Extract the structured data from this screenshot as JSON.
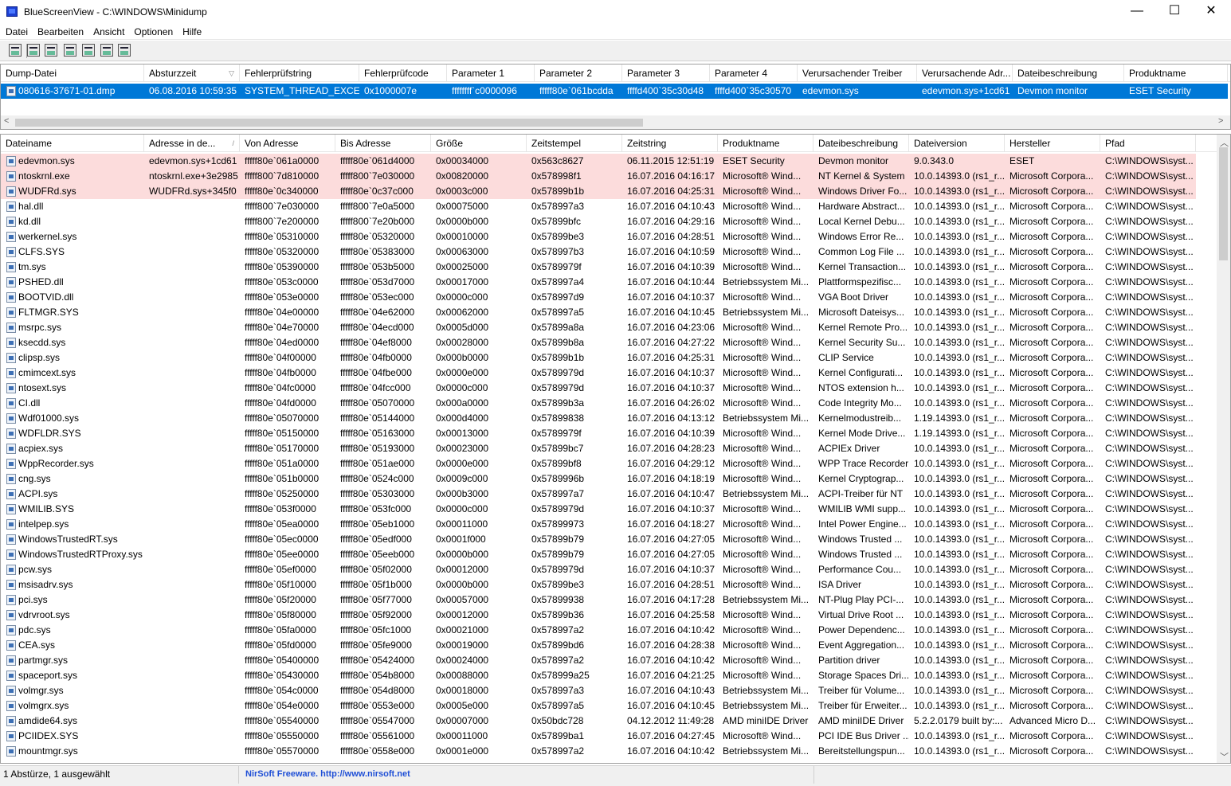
{
  "window": {
    "title": "BlueScreenView  -  C:\\WINDOWS\\Minidump",
    "minimize_glyph": "—",
    "maximize_glyph": "☐",
    "close_glyph": "✕"
  },
  "menu": [
    "Datei",
    "Bearbeiten",
    "Ansicht",
    "Optionen",
    "Hilfe"
  ],
  "toolbar_icons": [
    "properties-icon",
    "save-icon",
    "refresh-icon",
    "copy-icon",
    "html-report-icon",
    "find-icon",
    "exit-icon"
  ],
  "top_table": {
    "columns": [
      "Dump-Datei",
      "Absturzzeit",
      "Fehlerprüfstring",
      "Fehlerprüfcode",
      "Parameter 1",
      "Parameter 2",
      "Parameter 3",
      "Parameter 4",
      "Verursachender Treiber",
      "Verursachende Adr...",
      "Dateibeschreibung",
      "Produktname"
    ],
    "sort_column": "Absturzzeit",
    "sort_glyph": "▽",
    "rows": [
      [
        "080616-37671-01.dmp",
        "06.08.2016 10:59:35",
        "SYSTEM_THREAD_EXCE...",
        "0x1000007e",
        "ffffffff`c0000096",
        "fffff80e`061bcdda",
        "ffffd400`35c30d48",
        "ffffd400`35c30570",
        "edevmon.sys",
        "edevmon.sys+1cd61",
        "Devmon monitor",
        "ESET Security"
      ]
    ]
  },
  "bottom_table": {
    "columns": [
      "Dateiname",
      "Adresse in de...",
      "Von Adresse",
      "Bis Adresse",
      "Größe",
      "Zeitstempel",
      "Zeitstring",
      "Produktname",
      "Dateibeschreibung",
      "Dateiversion",
      "Hersteller",
      "Pfad"
    ],
    "sort_glyph": "/",
    "rows": [
      [
        "edevmon.sys",
        "edevmon.sys+1cd61",
        "fffff80e`061a0000",
        "fffff80e`061d4000",
        "0x00034000",
        "0x563c8627",
        "06.11.2015 12:51:19",
        "ESET Security",
        "Devmon monitor",
        "9.0.343.0",
        "ESET",
        "C:\\WINDOWS\\syst..."
      ],
      [
        "ntoskrnl.exe",
        "ntoskrnl.exe+3e2985",
        "fffff800`7d810000",
        "fffff800`7e030000",
        "0x00820000",
        "0x578998f1",
        "16.07.2016 04:16:17",
        "Microsoft® Wind...",
        "NT Kernel & System",
        "10.0.14393.0 (rs1_r...",
        "Microsoft Corpora...",
        "C:\\WINDOWS\\syst..."
      ],
      [
        "WUDFRd.sys",
        "WUDFRd.sys+345f0",
        "fffff80e`0c340000",
        "fffff80e`0c37c000",
        "0x0003c000",
        "0x57899b1b",
        "16.07.2016 04:25:31",
        "Microsoft® Wind...",
        "Windows Driver Fo...",
        "10.0.14393.0 (rs1_r...",
        "Microsoft Corpora...",
        "C:\\WINDOWS\\syst..."
      ],
      [
        "hal.dll",
        "",
        "fffff800`7e030000",
        "fffff800`7e0a5000",
        "0x00075000",
        "0x578997a3",
        "16.07.2016 04:10:43",
        "Microsoft® Wind...",
        "Hardware Abstract...",
        "10.0.14393.0 (rs1_r...",
        "Microsoft Corpora...",
        "C:\\WINDOWS\\syst..."
      ],
      [
        "kd.dll",
        "",
        "fffff800`7e200000",
        "fffff800`7e20b000",
        "0x0000b000",
        "0x57899bfc",
        "16.07.2016 04:29:16",
        "Microsoft® Wind...",
        "Local Kernel Debu...",
        "10.0.14393.0 (rs1_r...",
        "Microsoft Corpora...",
        "C:\\WINDOWS\\syst..."
      ],
      [
        "werkernel.sys",
        "",
        "fffff80e`05310000",
        "fffff80e`05320000",
        "0x00010000",
        "0x57899be3",
        "16.07.2016 04:28:51",
        "Microsoft® Wind...",
        "Windows Error Re...",
        "10.0.14393.0 (rs1_r...",
        "Microsoft Corpora...",
        "C:\\WINDOWS\\syst..."
      ],
      [
        "CLFS.SYS",
        "",
        "fffff80e`05320000",
        "fffff80e`05383000",
        "0x00063000",
        "0x578997b3",
        "16.07.2016 04:10:59",
        "Microsoft® Wind...",
        "Common Log File ...",
        "10.0.14393.0 (rs1_r...",
        "Microsoft Corpora...",
        "C:\\WINDOWS\\syst..."
      ],
      [
        "tm.sys",
        "",
        "fffff80e`05390000",
        "fffff80e`053b5000",
        "0x00025000",
        "0x5789979f",
        "16.07.2016 04:10:39",
        "Microsoft® Wind...",
        "Kernel Transaction...",
        "10.0.14393.0 (rs1_r...",
        "Microsoft Corpora...",
        "C:\\WINDOWS\\syst..."
      ],
      [
        "PSHED.dll",
        "",
        "fffff80e`053c0000",
        "fffff80e`053d7000",
        "0x00017000",
        "0x578997a4",
        "16.07.2016 04:10:44",
        "Betriebssystem Mi...",
        "Plattformspezifisc...",
        "10.0.14393.0 (rs1_r...",
        "Microsoft Corpora...",
        "C:\\WINDOWS\\syst..."
      ],
      [
        "BOOTVID.dll",
        "",
        "fffff80e`053e0000",
        "fffff80e`053ec000",
        "0x0000c000",
        "0x578997d9",
        "16.07.2016 04:10:37",
        "Microsoft® Wind...",
        "VGA Boot Driver",
        "10.0.14393.0 (rs1_r...",
        "Microsoft Corpora...",
        "C:\\WINDOWS\\syst..."
      ],
      [
        "FLTMGR.SYS",
        "",
        "fffff80e`04e00000",
        "fffff80e`04e62000",
        "0x00062000",
        "0x578997a5",
        "16.07.2016 04:10:45",
        "Betriebssystem Mi...",
        "Microsoft Dateisys...",
        "10.0.14393.0 (rs1_r...",
        "Microsoft Corpora...",
        "C:\\WINDOWS\\syst..."
      ],
      [
        "msrpc.sys",
        "",
        "fffff80e`04e70000",
        "fffff80e`04ecd000",
        "0x0005d000",
        "0x57899a8a",
        "16.07.2016 04:23:06",
        "Microsoft® Wind...",
        "Kernel Remote Pro...",
        "10.0.14393.0 (rs1_r...",
        "Microsoft Corpora...",
        "C:\\WINDOWS\\syst..."
      ],
      [
        "ksecdd.sys",
        "",
        "fffff80e`04ed0000",
        "fffff80e`04ef8000",
        "0x00028000",
        "0x57899b8a",
        "16.07.2016 04:27:22",
        "Microsoft® Wind...",
        "Kernel Security Su...",
        "10.0.14393.0 (rs1_r...",
        "Microsoft Corpora...",
        "C:\\WINDOWS\\syst..."
      ],
      [
        "clipsp.sys",
        "",
        "fffff80e`04f00000",
        "fffff80e`04fb0000",
        "0x000b0000",
        "0x57899b1b",
        "16.07.2016 04:25:31",
        "Microsoft® Wind...",
        "CLIP Service",
        "10.0.14393.0 (rs1_r...",
        "Microsoft Corpora...",
        "C:\\WINDOWS\\syst..."
      ],
      [
        "cmimcext.sys",
        "",
        "fffff80e`04fb0000",
        "fffff80e`04fbe000",
        "0x0000e000",
        "0x5789979d",
        "16.07.2016 04:10:37",
        "Microsoft® Wind...",
        "Kernel Configurati...",
        "10.0.14393.0 (rs1_r...",
        "Microsoft Corpora...",
        "C:\\WINDOWS\\syst..."
      ],
      [
        "ntosext.sys",
        "",
        "fffff80e`04fc0000",
        "fffff80e`04fcc000",
        "0x0000c000",
        "0x5789979d",
        "16.07.2016 04:10:37",
        "Microsoft® Wind...",
        "NTOS extension h...",
        "10.0.14393.0 (rs1_r...",
        "Microsoft Corpora...",
        "C:\\WINDOWS\\syst..."
      ],
      [
        "CI.dll",
        "",
        "fffff80e`04fd0000",
        "fffff80e`05070000",
        "0x000a0000",
        "0x57899b3a",
        "16.07.2016 04:26:02",
        "Microsoft® Wind...",
        "Code Integrity Mo...",
        "10.0.14393.0 (rs1_r...",
        "Microsoft Corpora...",
        "C:\\WINDOWS\\syst..."
      ],
      [
        "Wdf01000.sys",
        "",
        "fffff80e`05070000",
        "fffff80e`05144000",
        "0x000d4000",
        "0x57899838",
        "16.07.2016 04:13:12",
        "Betriebssystem Mi...",
        "Kernelmodustreib...",
        "1.19.14393.0 (rs1_r...",
        "Microsoft Corpora...",
        "C:\\WINDOWS\\syst..."
      ],
      [
        "WDFLDR.SYS",
        "",
        "fffff80e`05150000",
        "fffff80e`05163000",
        "0x00013000",
        "0x5789979f",
        "16.07.2016 04:10:39",
        "Microsoft® Wind...",
        "Kernel Mode Drive...",
        "1.19.14393.0 (rs1_r...",
        "Microsoft Corpora...",
        "C:\\WINDOWS\\syst..."
      ],
      [
        "acpiex.sys",
        "",
        "fffff80e`05170000",
        "fffff80e`05193000",
        "0x00023000",
        "0x57899bc7",
        "16.07.2016 04:28:23",
        "Microsoft® Wind...",
        "ACPIEx Driver",
        "10.0.14393.0 (rs1_r...",
        "Microsoft Corpora...",
        "C:\\WINDOWS\\syst..."
      ],
      [
        "WppRecorder.sys",
        "",
        "fffff80e`051a0000",
        "fffff80e`051ae000",
        "0x0000e000",
        "0x57899bf8",
        "16.07.2016 04:29:12",
        "Microsoft® Wind...",
        "WPP Trace Recorder",
        "10.0.14393.0 (rs1_r...",
        "Microsoft Corpora...",
        "C:\\WINDOWS\\syst..."
      ],
      [
        "cng.sys",
        "",
        "fffff80e`051b0000",
        "fffff80e`0524c000",
        "0x0009c000",
        "0x5789996b",
        "16.07.2016 04:18:19",
        "Microsoft® Wind...",
        "Kernel Cryptograp...",
        "10.0.14393.0 (rs1_r...",
        "Microsoft Corpora...",
        "C:\\WINDOWS\\syst..."
      ],
      [
        "ACPI.sys",
        "",
        "fffff80e`05250000",
        "fffff80e`05303000",
        "0x000b3000",
        "0x578997a7",
        "16.07.2016 04:10:47",
        "Betriebssystem Mi...",
        "ACPI-Treiber für NT",
        "10.0.14393.0 (rs1_r...",
        "Microsoft Corpora...",
        "C:\\WINDOWS\\syst..."
      ],
      [
        "WMILIB.SYS",
        "",
        "fffff80e`053f0000",
        "fffff80e`053fc000",
        "0x0000c000",
        "0x5789979d",
        "16.07.2016 04:10:37",
        "Microsoft® Wind...",
        "WMILIB WMI supp...",
        "10.0.14393.0 (rs1_r...",
        "Microsoft Corpora...",
        "C:\\WINDOWS\\syst..."
      ],
      [
        "intelpep.sys",
        "",
        "fffff80e`05ea0000",
        "fffff80e`05eb1000",
        "0x00011000",
        "0x57899973",
        "16.07.2016 04:18:27",
        "Microsoft® Wind...",
        "Intel Power Engine...",
        "10.0.14393.0 (rs1_r...",
        "Microsoft Corpora...",
        "C:\\WINDOWS\\syst..."
      ],
      [
        "WindowsTrustedRT.sys",
        "",
        "fffff80e`05ec0000",
        "fffff80e`05edf000",
        "0x0001f000",
        "0x57899b79",
        "16.07.2016 04:27:05",
        "Microsoft® Wind...",
        "Windows Trusted ...",
        "10.0.14393.0 (rs1_r...",
        "Microsoft Corpora...",
        "C:\\WINDOWS\\syst..."
      ],
      [
        "WindowsTrustedRTProxy.sys",
        "",
        "fffff80e`05ee0000",
        "fffff80e`05eeb000",
        "0x0000b000",
        "0x57899b79",
        "16.07.2016 04:27:05",
        "Microsoft® Wind...",
        "Windows Trusted ...",
        "10.0.14393.0 (rs1_r...",
        "Microsoft Corpora...",
        "C:\\WINDOWS\\syst..."
      ],
      [
        "pcw.sys",
        "",
        "fffff80e`05ef0000",
        "fffff80e`05f02000",
        "0x00012000",
        "0x5789979d",
        "16.07.2016 04:10:37",
        "Microsoft® Wind...",
        "Performance Cou...",
        "10.0.14393.0 (rs1_r...",
        "Microsoft Corpora...",
        "C:\\WINDOWS\\syst..."
      ],
      [
        "msisadrv.sys",
        "",
        "fffff80e`05f10000",
        "fffff80e`05f1b000",
        "0x0000b000",
        "0x57899be3",
        "16.07.2016 04:28:51",
        "Microsoft® Wind...",
        "ISA Driver",
        "10.0.14393.0 (rs1_r...",
        "Microsoft Corpora...",
        "C:\\WINDOWS\\syst..."
      ],
      [
        "pci.sys",
        "",
        "fffff80e`05f20000",
        "fffff80e`05f77000",
        "0x00057000",
        "0x57899938",
        "16.07.2016 04:17:28",
        "Betriebssystem Mi...",
        "NT-Plug  Play PCI-...",
        "10.0.14393.0 (rs1_r...",
        "Microsoft Corpora...",
        "C:\\WINDOWS\\syst..."
      ],
      [
        "vdrvroot.sys",
        "",
        "fffff80e`05f80000",
        "fffff80e`05f92000",
        "0x00012000",
        "0x57899b36",
        "16.07.2016 04:25:58",
        "Microsoft® Wind...",
        "Virtual Drive Root ...",
        "10.0.14393.0 (rs1_r...",
        "Microsoft Corpora...",
        "C:\\WINDOWS\\syst..."
      ],
      [
        "pdc.sys",
        "",
        "fffff80e`05fa0000",
        "fffff80e`05fc1000",
        "0x00021000",
        "0x578997a2",
        "16.07.2016 04:10:42",
        "Microsoft® Wind...",
        "Power Dependenc...",
        "10.0.14393.0 (rs1_r...",
        "Microsoft Corpora...",
        "C:\\WINDOWS\\syst..."
      ],
      [
        "CEA.sys",
        "",
        "fffff80e`05fd0000",
        "fffff80e`05fe9000",
        "0x00019000",
        "0x57899bd6",
        "16.07.2016 04:28:38",
        "Microsoft® Wind...",
        "Event Aggregation...",
        "10.0.14393.0 (rs1_r...",
        "Microsoft Corpora...",
        "C:\\WINDOWS\\syst..."
      ],
      [
        "partmgr.sys",
        "",
        "fffff80e`05400000",
        "fffff80e`05424000",
        "0x00024000",
        "0x578997a2",
        "16.07.2016 04:10:42",
        "Microsoft® Wind...",
        "Partition driver",
        "10.0.14393.0 (rs1_r...",
        "Microsoft Corpora...",
        "C:\\WINDOWS\\syst..."
      ],
      [
        "spaceport.sys",
        "",
        "fffff80e`05430000",
        "fffff80e`054b8000",
        "0x00088000",
        "0x578999a25",
        "16.07.2016 04:21:25",
        "Microsoft® Wind...",
        "Storage Spaces Dri...",
        "10.0.14393.0 (rs1_r...",
        "Microsoft Corpora...",
        "C:\\WINDOWS\\syst..."
      ],
      [
        "volmgr.sys",
        "",
        "fffff80e`054c0000",
        "fffff80e`054d8000",
        "0x00018000",
        "0x578997a3",
        "16.07.2016 04:10:43",
        "Betriebssystem Mi...",
        "Treiber für Volume...",
        "10.0.14393.0 (rs1_r...",
        "Microsoft Corpora...",
        "C:\\WINDOWS\\syst..."
      ],
      [
        "volmgrx.sys",
        "",
        "fffff80e`054e0000",
        "fffff80e`0553e000",
        "0x0005e000",
        "0x578997a5",
        "16.07.2016 04:10:45",
        "Betriebssystem Mi...",
        "Treiber für Erweiter...",
        "10.0.14393.0 (rs1_r...",
        "Microsoft Corpora...",
        "C:\\WINDOWS\\syst..."
      ],
      [
        "amdide64.sys",
        "",
        "fffff80e`05540000",
        "fffff80e`05547000",
        "0x00007000",
        "0x50bdc728",
        "04.12.2012 11:49:28",
        "AMD miniIDE Driver",
        "AMD miniIDE Driver",
        "5.2.2.0179 built by:...",
        "Advanced Micro D...",
        "C:\\WINDOWS\\syst..."
      ],
      [
        "PCIIDEX.SYS",
        "",
        "fffff80e`05550000",
        "fffff80e`05561000",
        "0x00011000",
        "0x57899ba1",
        "16.07.2016 04:27:45",
        "Microsoft® Wind...",
        "PCI IDE Bus Driver ...",
        "10.0.14393.0 (rs1_r...",
        "Microsoft Corpora...",
        "C:\\WINDOWS\\syst..."
      ],
      [
        "mountmgr.sys",
        "",
        "fffff80e`05570000",
        "fffff80e`0558e000",
        "0x0001e000",
        "0x578997a2",
        "16.07.2016 04:10:42",
        "Betriebssystem Mi...",
        "Bereitstellungspun...",
        "10.0.14393.0 (rs1_r...",
        "Microsoft Corpora...",
        "C:\\WINDOWS\\syst..."
      ]
    ]
  },
  "status": {
    "count": "1 Abstürze, 1 ausgewählt",
    "credit": "NirSoft Freeware.  http://www.nirsoft.net"
  },
  "colors": {
    "selection": "#0078d7",
    "highlight": "#fcdcdc",
    "link": "#1f4fd6"
  }
}
